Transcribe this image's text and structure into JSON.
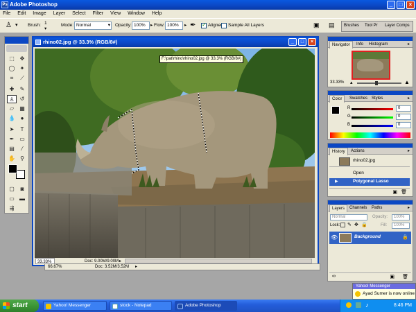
{
  "app": {
    "title": "Adobe Photoshop"
  },
  "menu": [
    "File",
    "Edit",
    "Image",
    "Layer",
    "Select",
    "Filter",
    "View",
    "Window",
    "Help"
  ],
  "options": {
    "brush_label": "Brush:",
    "brush_size": "1",
    "mode_label": "Mode:",
    "mode_value": "Normal",
    "opacity_label": "Opacity:",
    "opacity_value": "100%",
    "flow_label": "Flow:",
    "flow_value": "100%",
    "aligned_label": "Aligned",
    "sample_all_label": "Sample All Layers",
    "well_tabs": [
      "Brushes",
      "Tool Pr",
      "Layer Comps"
    ]
  },
  "document": {
    "title": "rhino02.jpg @ 33.3% (RGB/8#)",
    "tooltip": "F:\\pat\\rhino\\rhino02.jpg @ 33.3% (RGB/8#)",
    "zoom": "33.33%",
    "doc_size": "Doc: 9.00M/9.00M"
  },
  "document2": {
    "zoom": "66.67%",
    "doc_size": "Doc: 3.52M/3.52M"
  },
  "navigator": {
    "tabs": [
      "Navigator",
      "Info",
      "Histogram"
    ],
    "zoom": "33.33%"
  },
  "color": {
    "tabs": [
      "Color",
      "Swatches",
      "Styles"
    ],
    "channels": [
      {
        "label": "R",
        "value": "0",
        "color": "#ff0000"
      },
      {
        "label": "G",
        "value": "0",
        "color": "#00a000"
      },
      {
        "label": "B",
        "value": "0",
        "color": "#0000ff"
      }
    ]
  },
  "history": {
    "tabs": [
      "History",
      "Actions"
    ],
    "snapshot": "rhino02.jpg",
    "items": [
      "Open",
      "Polygonal Lasso"
    ]
  },
  "layers": {
    "tabs": [
      "Layers",
      "Channels",
      "Paths"
    ],
    "blend_mode": "Normal",
    "opacity_label": "Opacity:",
    "opacity_value": "100%",
    "lock_label": "Lock:",
    "fill_label": "Fill:",
    "fill_value": "100%",
    "layer_name": "Background"
  },
  "taskbar": {
    "start": "start",
    "tasks": [
      "Yahoo! Messenger",
      "stock - Notepad",
      "Adobe Photoshop"
    ],
    "clock": "8:46 PM"
  },
  "notification": {
    "title": "Yahoo! Messenger",
    "message": "Ayad Sumer is now online"
  },
  "colors": {
    "title_blue": "#0b47c4",
    "xp_beige": "#ece9d8",
    "history_selected": "#3163c5"
  }
}
